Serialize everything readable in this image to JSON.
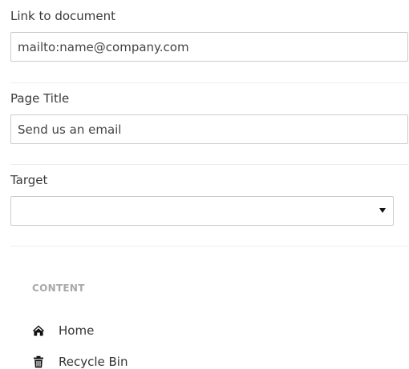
{
  "form": {
    "link": {
      "label": "Link to document",
      "value": "mailto:name@company.com"
    },
    "page_title": {
      "label": "Page Title",
      "value": "Send us an email"
    },
    "target": {
      "label": "Target",
      "value": ""
    }
  },
  "tree": {
    "section_label": "CONTENT",
    "items": [
      {
        "label": "Home",
        "icon": "home-icon"
      },
      {
        "label": "Recycle Bin",
        "icon": "trash-icon"
      }
    ]
  }
}
